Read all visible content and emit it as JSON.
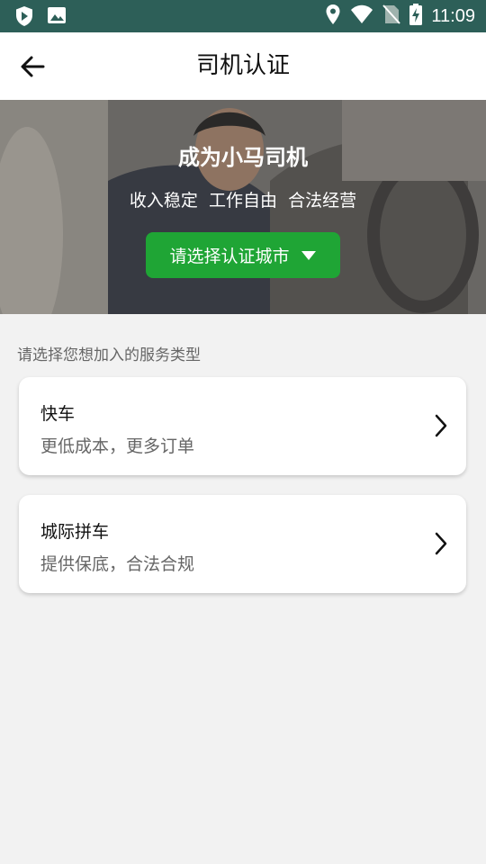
{
  "status_bar": {
    "time": "11:09",
    "icons_left": [
      "shield-icon",
      "image-icon"
    ],
    "icons_right": [
      "location-icon",
      "wifi-icon",
      "no-sim-icon",
      "battery-charging-icon"
    ],
    "background": "#2d5f58"
  },
  "header": {
    "title": "司机认证",
    "back_icon": "arrow-left-icon"
  },
  "banner": {
    "headline": "成为小马司机",
    "slogan": "收入稳定  工作自由  合法经营",
    "city_button": {
      "label": "请选择认证城市",
      "icon": "caret-down-icon",
      "color": "#1fa535"
    }
  },
  "services": {
    "label": "请选择您想加入的服务类型",
    "items": [
      {
        "title": "快车",
        "subtitle": "更低成本，更多订单",
        "icon": "chevron-right-icon"
      },
      {
        "title": "城际拼车",
        "subtitle": "提供保底，合法合规",
        "icon": "chevron-right-icon"
      }
    ]
  }
}
